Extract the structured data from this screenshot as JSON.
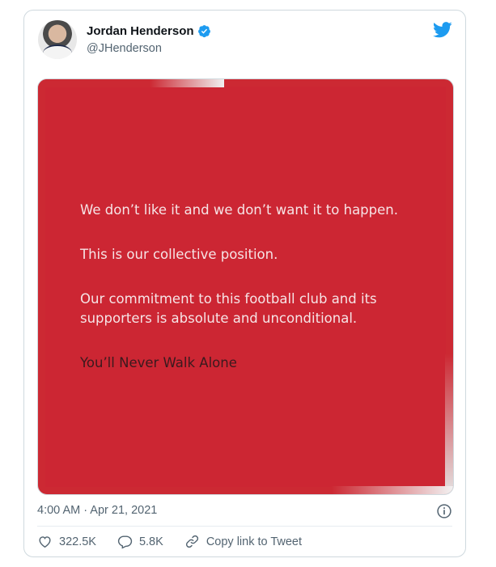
{
  "author": {
    "name": "Jordan Henderson",
    "handle": "@JHenderson"
  },
  "statement": {
    "line1": "We don’t like it and we don’t want it to happen.",
    "line2": "This is our collective position.",
    "line3": "Our commitment to this football club and its supporters is absolute and unconditional.",
    "closing": "You’ll Never Walk Alone"
  },
  "meta": {
    "timestamp": "4:00 AM · Apr 21, 2021"
  },
  "actions": {
    "likes": "322.5K",
    "replies": "5.8K",
    "copy_link": "Copy link to Tweet"
  },
  "colors": {
    "brand_blue": "#1d9bf0",
    "statement_red": "#cc2633"
  },
  "icons": [
    "verified-badge-icon",
    "twitter-bird-icon",
    "info-icon",
    "heart-icon",
    "reply-icon",
    "link-icon"
  ]
}
